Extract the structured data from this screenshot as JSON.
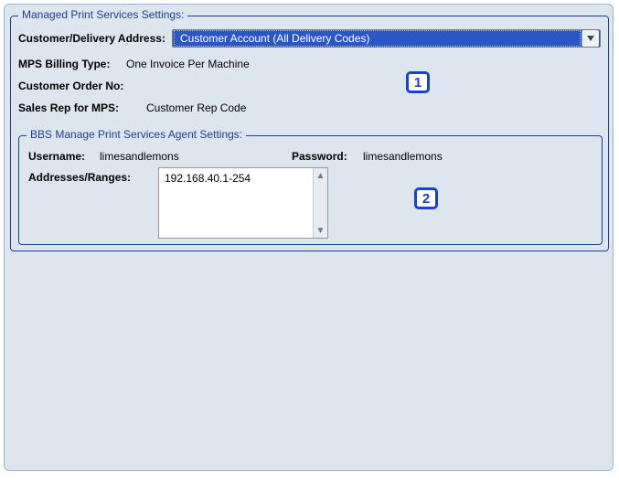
{
  "outer": {
    "legend": "Managed Print Services Settings:",
    "rows": {
      "address_label": "Customer/Delivery Address:",
      "address_selected": "Customer Account (All Delivery Codes)",
      "billing_label": "MPS Billing Type:",
      "billing_value": "One Invoice Per Machine",
      "order_label": "Customer Order No:",
      "order_value": "",
      "rep_label": "Sales Rep for MPS:",
      "rep_value": "Customer Rep Code"
    }
  },
  "inner": {
    "legend": "BBS Manage Print Services Agent Settings:",
    "username_label": "Username:",
    "username_value": "limesandlemons",
    "password_label": "Password:",
    "password_value": "limesandlemons",
    "addresses_label": "Addresses/Ranges:",
    "addresses_value": "192.168.40.1-254"
  },
  "callouts": {
    "one": "1",
    "two": "2"
  }
}
